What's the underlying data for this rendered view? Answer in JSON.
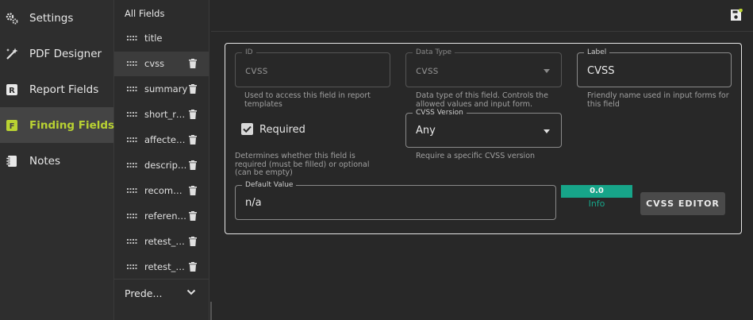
{
  "nav": {
    "items": [
      {
        "label": "Settings",
        "icon": "gears-icon"
      },
      {
        "label": "PDF Designer",
        "icon": "magic-wand-icon"
      },
      {
        "label": "Report Fields",
        "icon": "report-fields-icon"
      },
      {
        "label": "Finding Fields",
        "icon": "finding-fields-icon",
        "active": true
      },
      {
        "label": "Notes",
        "icon": "notebook-icon"
      }
    ],
    "accent_color": "#b9d232"
  },
  "field_list": {
    "header": "All Fields",
    "items": [
      {
        "name": "title",
        "deletable": false
      },
      {
        "name": "cvss",
        "deletable": true,
        "active": true
      },
      {
        "name": "summary",
        "deletable": true
      },
      {
        "name": "short_recommendation",
        "deletable": true
      },
      {
        "name": "affected_components",
        "deletable": true
      },
      {
        "name": "description",
        "deletable": true
      },
      {
        "name": "recommendation",
        "deletable": true
      },
      {
        "name": "references",
        "deletable": true
      },
      {
        "name": "retest_status",
        "deletable": true
      },
      {
        "name": "retest_notes",
        "deletable": true
      }
    ],
    "predefined_label": "Prede..."
  },
  "form": {
    "id": {
      "legend": "ID",
      "value": "cvss",
      "help": "Used to access this field in report templates"
    },
    "data_type": {
      "legend": "Data Type",
      "value": "cvss",
      "help": "Data type of this field. Controls the allowed values and input form."
    },
    "label": {
      "legend": "Label",
      "value": "CVSS",
      "help": "Friendly name used in input forms for this field"
    },
    "required": {
      "label": "Required",
      "checked": true,
      "help": "Determines whether this field is required (must be filled) or optional (can be empty)"
    },
    "cvss_version": {
      "legend": "CVSS Version",
      "value": "Any",
      "help": "Require a specific CVSS version"
    },
    "default_value": {
      "legend": "Default Value",
      "value": "n/a"
    },
    "cvss_score": "0.0",
    "cvss_severity": "Info",
    "score_color": "#17a589",
    "editor_button": "CVSS EDITOR"
  }
}
